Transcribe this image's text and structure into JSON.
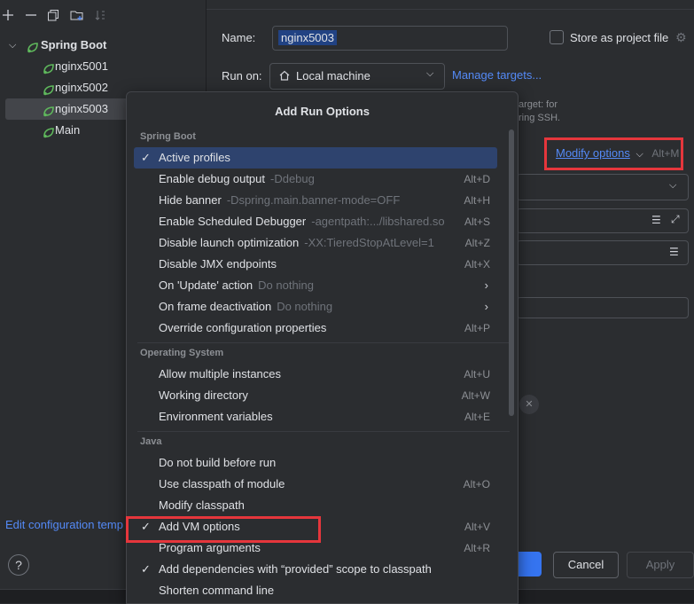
{
  "tree": {
    "root_label": "Spring Boot",
    "items": [
      {
        "label": "nginx5001",
        "selected": false
      },
      {
        "label": "nginx5002",
        "selected": false
      },
      {
        "label": "nginx5003",
        "selected": true
      },
      {
        "label": "Main",
        "selected": false
      }
    ]
  },
  "toolbar": {
    "icons": [
      "add-icon",
      "remove-icon",
      "copy-icon",
      "folder-add-icon",
      "sort-icon"
    ]
  },
  "left_footer": {
    "edit_config_link": "Edit configuration temp",
    "help_glyph": "?"
  },
  "form": {
    "name_label": "Name:",
    "name_value": "nginx5003",
    "store_label": "Store as project file",
    "run_on_label": "Run on:",
    "run_on_value": "Local machine",
    "manage_targets": "Manage targets...",
    "hint_line1": "arget: for",
    "hint_line2": "ring SSH.",
    "modify_options": "Modify options",
    "modify_shortcut": "Alt+M"
  },
  "buttons": {
    "cancel": "Cancel",
    "apply": "Apply"
  },
  "popup": {
    "title": "Add Run Options",
    "sections": [
      {
        "title": "Spring Boot",
        "items": [
          {
            "label": "Active profiles",
            "hint": "",
            "shortcut": "",
            "checked": true,
            "active": true,
            "submenu": false
          },
          {
            "label": "Enable debug output",
            "hint": "-Ddebug",
            "shortcut": "Alt+D",
            "checked": false,
            "active": false,
            "submenu": false
          },
          {
            "label": "Hide banner",
            "hint": "-Dspring.main.banner-mode=OFF",
            "shortcut": "Alt+H",
            "checked": false,
            "active": false,
            "submenu": false
          },
          {
            "label": "Enable Scheduled Debugger",
            "hint": "-agentpath:.../libshared.so",
            "shortcut": "Alt+S",
            "checked": false,
            "active": false,
            "submenu": false
          },
          {
            "label": "Disable launch optimization",
            "hint": "-XX:TieredStopAtLevel=1",
            "shortcut": "Alt+Z",
            "checked": false,
            "active": false,
            "submenu": false
          },
          {
            "label": "Disable JMX endpoints",
            "hint": "",
            "shortcut": "Alt+X",
            "checked": false,
            "active": false,
            "submenu": false
          },
          {
            "label": "On 'Update' action",
            "hint": "Do nothing",
            "shortcut": "",
            "checked": false,
            "active": false,
            "submenu": true
          },
          {
            "label": "On frame deactivation",
            "hint": "Do nothing",
            "shortcut": "",
            "checked": false,
            "active": false,
            "submenu": true
          },
          {
            "label": "Override configuration properties",
            "hint": "",
            "shortcut": "Alt+P",
            "checked": false,
            "active": false,
            "submenu": false
          }
        ]
      },
      {
        "title": "Operating System",
        "items": [
          {
            "label": "Allow multiple instances",
            "hint": "",
            "shortcut": "Alt+U",
            "checked": false,
            "active": false,
            "submenu": false
          },
          {
            "label": "Working directory",
            "hint": "",
            "shortcut": "Alt+W",
            "checked": false,
            "active": false,
            "submenu": false
          },
          {
            "label": "Environment variables",
            "hint": "",
            "shortcut": "Alt+E",
            "checked": false,
            "active": false,
            "submenu": false
          }
        ]
      },
      {
        "title": "Java",
        "items": [
          {
            "label": "Do not build before run",
            "hint": "",
            "shortcut": "",
            "checked": false,
            "active": false,
            "submenu": false
          },
          {
            "label": "Use classpath of module",
            "hint": "",
            "shortcut": "Alt+O",
            "checked": false,
            "active": false,
            "submenu": false
          },
          {
            "label": "Modify classpath",
            "hint": "",
            "shortcut": "",
            "checked": false,
            "active": false,
            "submenu": false
          },
          {
            "label": "Add VM options",
            "hint": "",
            "shortcut": "Alt+V",
            "checked": true,
            "active": false,
            "submenu": false
          },
          {
            "label": "Program arguments",
            "hint": "",
            "shortcut": "Alt+R",
            "checked": false,
            "active": false,
            "submenu": false
          },
          {
            "label": "Add dependencies with “provided” scope to classpath",
            "hint": "",
            "shortcut": "",
            "checked": true,
            "active": false,
            "submenu": false
          },
          {
            "label": "Shorten command line",
            "hint": "",
            "shortcut": "",
            "checked": false,
            "active": false,
            "submenu": false
          }
        ]
      }
    ]
  },
  "colors": {
    "background": "#2b2d30",
    "link": "#548af7",
    "highlight_box": "#e5363c",
    "selection": "#2e436e",
    "spring_green": "#5fb85c"
  }
}
